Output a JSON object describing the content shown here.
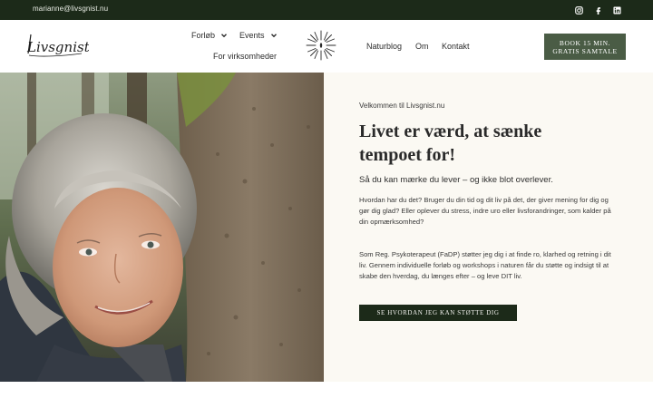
{
  "topbar": {
    "email": "marianne@livsgnist.nu",
    "socials": [
      "instagram-icon",
      "facebook-icon",
      "linkedin-icon"
    ]
  },
  "header": {
    "logo_text": "Livsgnist.nu",
    "nav": {
      "forlob": "Forløb",
      "events": "Events",
      "virksomheder": "For virksomheder",
      "naturblog": "Naturblog",
      "om": "Om",
      "kontakt": "Kontakt"
    },
    "cta_line1": "BOOK 15 MIN.",
    "cta_line2": "GRATIS SAMTALE"
  },
  "hero": {
    "welcome": "Velkommen til Livsgnist.nu",
    "headline": "Livet er værd, at sænke tempoet for!",
    "subhead": "Så du kan mærke du lever – og ikke blot overlever.",
    "para1": "Hvordan har du det? Bruger du din tid og dit liv på det, der giver mening for dig og gør dig glad? Eller oplever du stress, indre uro eller livsforandringer, som kalder på din opmærksomhed?",
    "para2": "Som Reg. Psykoterapeut (FaDP) støtter jeg dig i at finde ro, klarhed og retning i dit liv. Gennem individuelle forløb og workshops i naturen får du støtte og indsigt til at skabe den hverdag, du længes efter – og leve DIT liv.",
    "button": "SE HVORDAN JEG KAN STØTTE DIG"
  },
  "colors": {
    "dark_green": "#1c2a19",
    "cta_green": "#4a5c45",
    "cream": "#fbf9f3"
  }
}
